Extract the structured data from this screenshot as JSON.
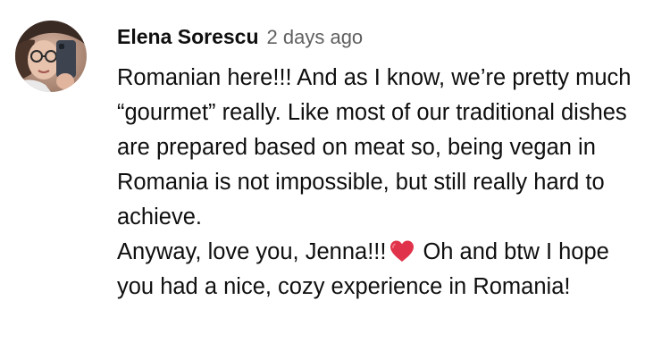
{
  "comment": {
    "author": "Elena Sorescu",
    "timestamp": "2 days ago",
    "paragraph1": "Romanian here!!! And as I know, we’re pretty much “gourmet” really. Like most of our traditional dishes are prepared based on meat so, being vegan in Romania is not impossible, but still really hard to achieve.",
    "paragraph2_before_emoji": "Anyway, love you, Jenna!!!",
    "emoji": "heart-icon",
    "paragraph2_after_emoji": "Oh and btw I hope you had a nice, cozy experience in Romania!"
  },
  "colors": {
    "author": "#0f0f0f",
    "timestamp": "#606060",
    "text": "#0f0f0f",
    "heart": "#e0324a",
    "background": "#ffffff"
  }
}
